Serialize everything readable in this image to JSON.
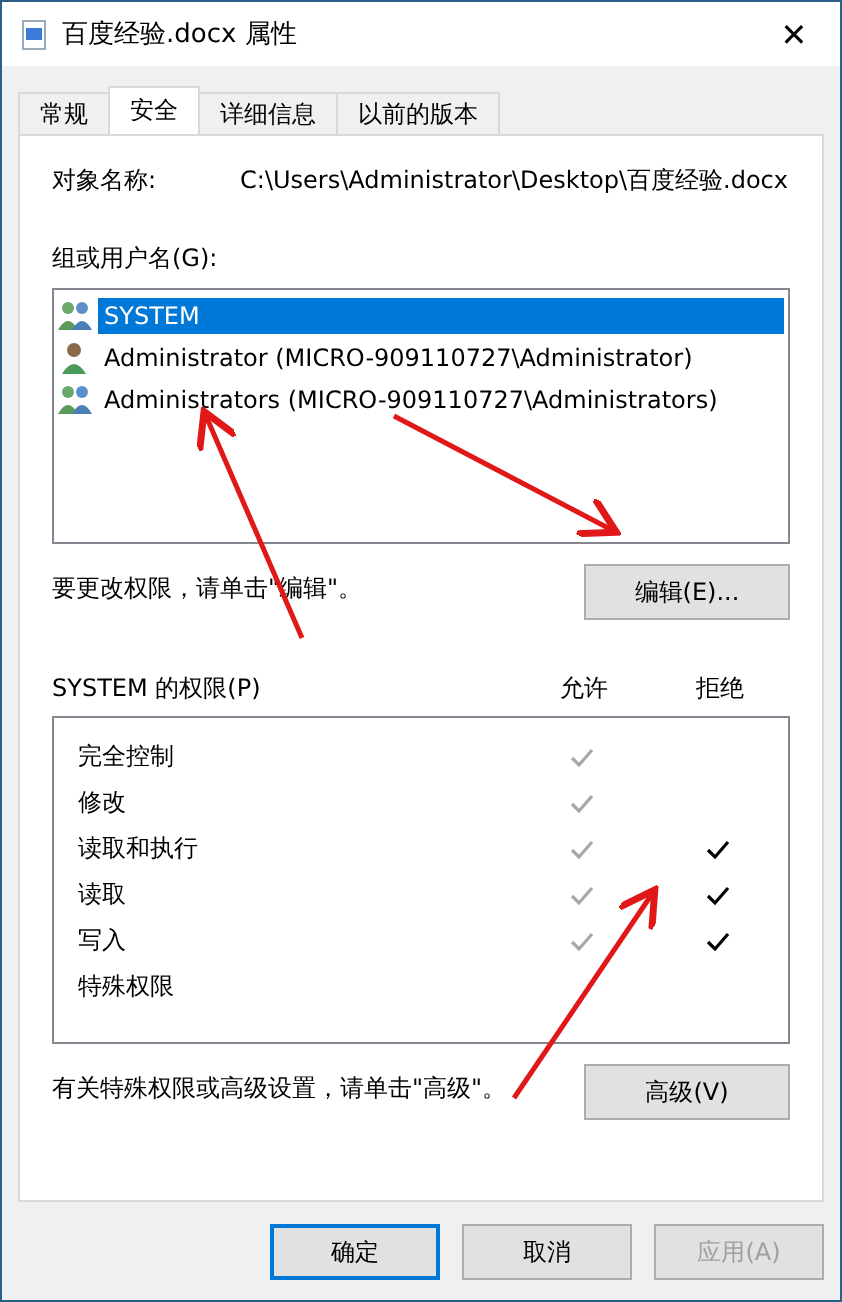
{
  "window": {
    "title": "百度经验.docx 属性",
    "close": "✕"
  },
  "tabs": [
    {
      "label": "常规",
      "selected": false
    },
    {
      "label": "安全",
      "selected": true
    },
    {
      "label": "详细信息",
      "selected": false
    },
    {
      "label": "以前的版本",
      "selected": false
    }
  ],
  "object_name": {
    "label": "对象名称:",
    "value": "C:\\Users\\Administrator\\Desktop\\百度经验.docx"
  },
  "groups": {
    "label": "组或用户名(G):",
    "items": [
      {
        "name": "SYSTEM",
        "kind": "group",
        "selected": true
      },
      {
        "name": "Administrator (MICRO-909110727\\Administrator)",
        "kind": "user",
        "selected": false
      },
      {
        "name": "Administrators (MICRO-909110727\\Administrators)",
        "kind": "group",
        "selected": false
      }
    ]
  },
  "edit_hint": "要更改权限，请单击\"编辑\"。",
  "edit_button": "编辑(E)...",
  "permissions": {
    "label": "SYSTEM 的权限(P)",
    "allow_header": "允许",
    "deny_header": "拒绝",
    "rows": [
      {
        "name": "完全控制",
        "allow": true,
        "deny": false
      },
      {
        "name": "修改",
        "allow": true,
        "deny": false
      },
      {
        "name": "读取和执行",
        "allow": true,
        "deny": true
      },
      {
        "name": "读取",
        "allow": true,
        "deny": true
      },
      {
        "name": "写入",
        "allow": true,
        "deny": true
      },
      {
        "name": "特殊权限",
        "allow": false,
        "deny": false
      }
    ]
  },
  "advanced_hint": "有关特殊权限或高级设置，请单击\"高级\"。",
  "advanced_button": "高级(V)",
  "buttons": [
    {
      "label": "确定",
      "disabled": false,
      "default": true
    },
    {
      "label": "取消",
      "disabled": false,
      "default": false
    },
    {
      "label": "应用(A)",
      "disabled": true,
      "default": false
    }
  ]
}
